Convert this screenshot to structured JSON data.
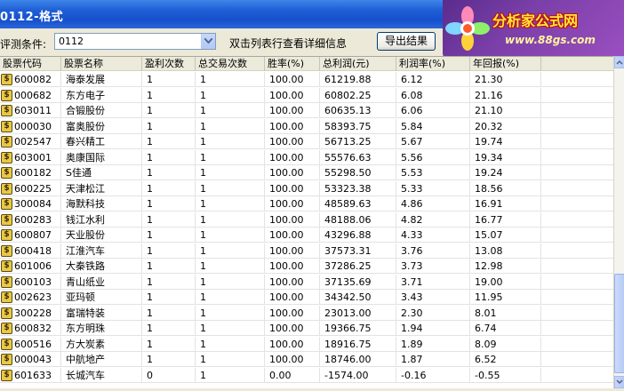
{
  "window": {
    "title": "0112-格式"
  },
  "logo": {
    "name": "分析家公式网",
    "url": "www.88gs.com"
  },
  "condition": {
    "label": "评测条件:",
    "value": "0112"
  },
  "hint": "双击列表行查看详细信息",
  "export_label": "导出结果",
  "table": {
    "columns": [
      "股票代码",
      "股票名称",
      "盈利次数",
      "总交易次数",
      "胜率(%)",
      "总利润(元)",
      "利润率(%)",
      "年回报(%)"
    ],
    "rows": [
      [
        "600082",
        "海泰发展",
        "1",
        "1",
        "100.00",
        "61219.88",
        "6.12",
        "21.30"
      ],
      [
        "000682",
        "东方电子",
        "1",
        "1",
        "100.00",
        "60802.25",
        "6.08",
        "21.16"
      ],
      [
        "603011",
        "合锻股份",
        "1",
        "1",
        "100.00",
        "60635.13",
        "6.06",
        "21.10"
      ],
      [
        "000030",
        "富奥股份",
        "1",
        "1",
        "100.00",
        "58393.75",
        "5.84",
        "20.32"
      ],
      [
        "002547",
        "春兴精工",
        "1",
        "1",
        "100.00",
        "56713.25",
        "5.67",
        "19.74"
      ],
      [
        "603001",
        "奥康国际",
        "1",
        "1",
        "100.00",
        "55576.63",
        "5.56",
        "19.34"
      ],
      [
        "600182",
        "S佳通",
        "1",
        "1",
        "100.00",
        "55298.50",
        "5.53",
        "19.24"
      ],
      [
        "600225",
        "天津松江",
        "1",
        "1",
        "100.00",
        "53323.38",
        "5.33",
        "18.56"
      ],
      [
        "300084",
        "海默科技",
        "1",
        "1",
        "100.00",
        "48589.63",
        "4.86",
        "16.91"
      ],
      [
        "600283",
        "钱江水利",
        "1",
        "1",
        "100.00",
        "48188.06",
        "4.82",
        "16.77"
      ],
      [
        "600807",
        "天业股份",
        "1",
        "1",
        "100.00",
        "43296.88",
        "4.33",
        "15.07"
      ],
      [
        "600418",
        "江淮汽车",
        "1",
        "1",
        "100.00",
        "37573.31",
        "3.76",
        "13.08"
      ],
      [
        "601006",
        "大秦铁路",
        "1",
        "1",
        "100.00",
        "37286.25",
        "3.73",
        "12.98"
      ],
      [
        "600103",
        "青山纸业",
        "1",
        "1",
        "100.00",
        "37135.69",
        "3.71",
        "19.00"
      ],
      [
        "002623",
        "亚玛顿",
        "1",
        "1",
        "100.00",
        "34342.50",
        "3.43",
        "11.95"
      ],
      [
        "300228",
        "富瑞特装",
        "1",
        "1",
        "100.00",
        "23013.00",
        "2.30",
        "8.01"
      ],
      [
        "600832",
        "东方明珠",
        "1",
        "1",
        "100.00",
        "19366.75",
        "1.94",
        "6.74"
      ],
      [
        "600516",
        "方大炭素",
        "1",
        "1",
        "100.00",
        "18916.75",
        "1.89",
        "8.09"
      ],
      [
        "000043",
        "中航地产",
        "1",
        "1",
        "100.00",
        "18746.00",
        "1.87",
        "6.52"
      ],
      [
        "601633",
        "长城汽车",
        "0",
        "1",
        "0.00",
        "-1574.00",
        "-0.16",
        "-0.55"
      ]
    ]
  },
  "colors": {
    "titlebar": "#1650cc",
    "window_bg": "#ece9d8",
    "grid_bg": "#ffffff"
  },
  "icons": {
    "row_icon": "dollar-coin-icon",
    "dropdown": "chevron-down-icon"
  }
}
